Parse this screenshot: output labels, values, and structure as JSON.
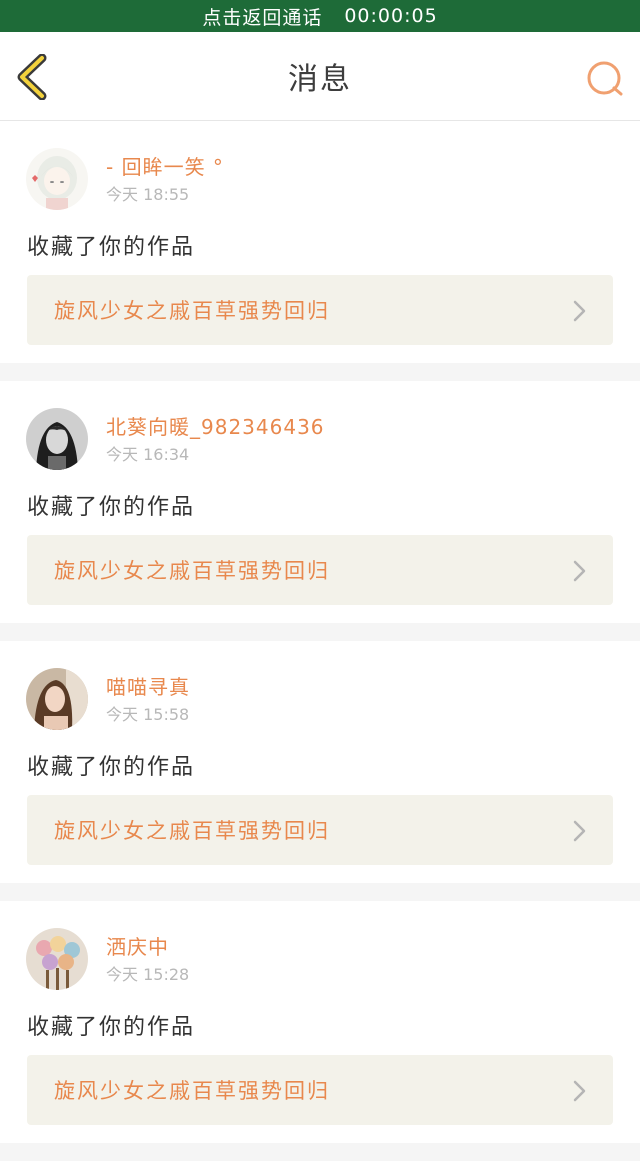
{
  "call_bar": {
    "text": "点击返回通话",
    "timer": "00:00:05"
  },
  "header": {
    "title": "消息"
  },
  "colors": {
    "accent": "#e8884d",
    "call_bar": "#1e6b38",
    "card_bg": "#f3f2ea"
  },
  "messages": [
    {
      "username": "- 回眸一笑 °",
      "time": "今天 18:55",
      "action": "收藏了你的作品",
      "work_title": "旋风少女之戚百草强势回归",
      "avatar_icon": "anime-girl-avatar"
    },
    {
      "username": "北葵向暖_982346436",
      "time": "今天 16:34",
      "action": "收藏了你的作品",
      "work_title": "旋风少女之戚百草强势回归",
      "avatar_icon": "bw-girl-avatar"
    },
    {
      "username": "喵喵寻真",
      "time": "今天 15:58",
      "action": "收藏了你的作品",
      "work_title": "旋风少女之戚百草强势回归",
      "avatar_icon": "girl-photo-avatar"
    },
    {
      "username": "洒庆中",
      "time": "今天 15:28",
      "action": "收藏了你的作品",
      "work_title": "旋风少女之戚百草强势回归",
      "avatar_icon": "flowers-avatar"
    }
  ]
}
